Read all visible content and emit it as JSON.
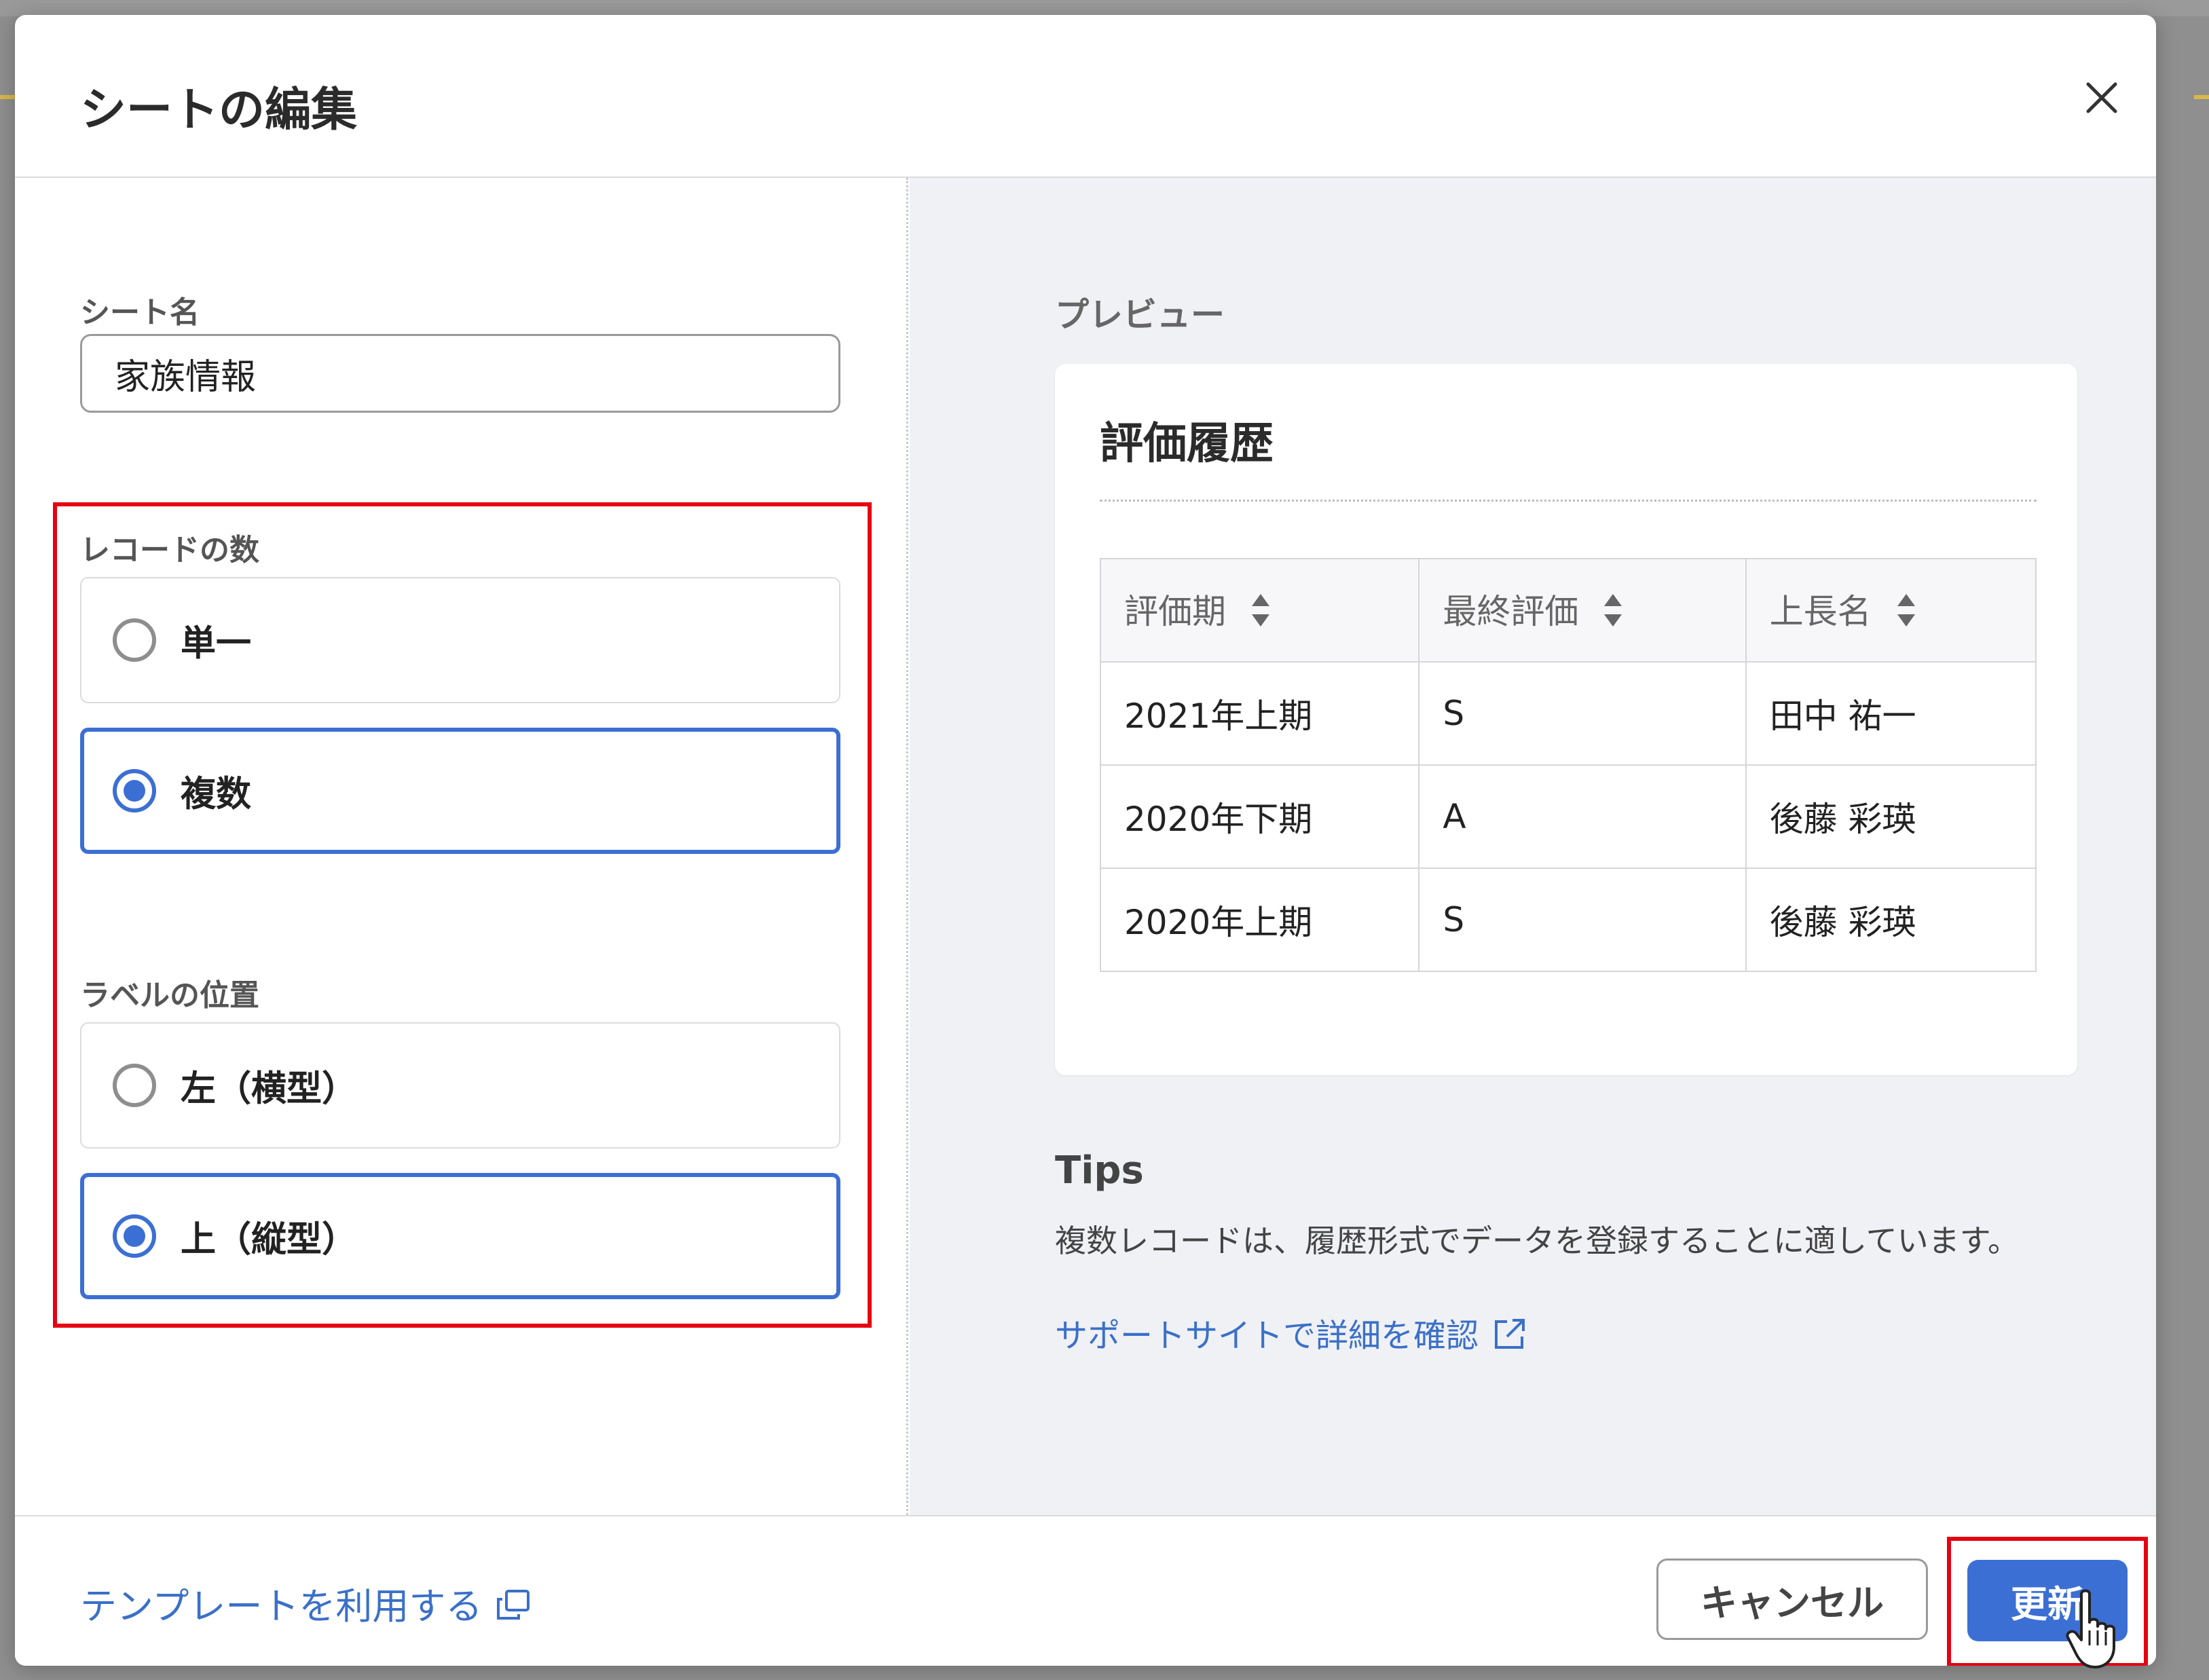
{
  "modal": {
    "title": "シートの編集"
  },
  "form": {
    "sheet_name_label": "シート名",
    "sheet_name_value": "家族情報",
    "record_count_label": "レコードの数",
    "record_options": [
      {
        "label": "単一",
        "selected": false
      },
      {
        "label": "複数",
        "selected": true
      }
    ],
    "label_position_label": "ラベルの位置",
    "position_options": [
      {
        "label": "左（横型）",
        "selected": false
      },
      {
        "label": "上（縦型）",
        "selected": true
      }
    ]
  },
  "preview": {
    "heading": "プレビュー",
    "card_title": "評価履歴",
    "columns": [
      "評価期",
      "最終評価",
      "上長名"
    ],
    "rows": [
      [
        "2021年上期",
        "S",
        "田中 祐一"
      ],
      [
        "2020年下期",
        "A",
        "後藤 彩瑛"
      ],
      [
        "2020年上期",
        "S",
        "後藤 彩瑛"
      ]
    ]
  },
  "tips": {
    "heading": "Tips",
    "text": "複数レコードは、履歴形式でデータを登録することに適しています。",
    "support_link": "サポートサイトで詳細を確認"
  },
  "footer": {
    "template_link": "テンプレートを利用する",
    "cancel_label": "キャンセル",
    "update_label": "更新"
  },
  "colors": {
    "accent": "#3c6fd4",
    "highlight": "#e60012",
    "link": "#3a70c8"
  }
}
